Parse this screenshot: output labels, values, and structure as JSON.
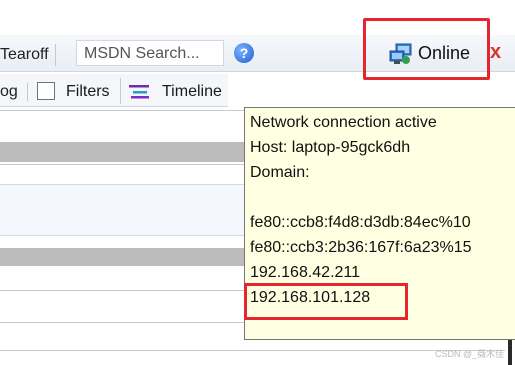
{
  "toolbar": {
    "tearoff_label": "Tearoff",
    "search_placeholder": "MSDN Search...",
    "help_glyph": "?",
    "online_label": "Online",
    "close_glyph": "x"
  },
  "filterbar": {
    "log_label": "og",
    "filters_label": "Filters",
    "timeline_label": "Timeline"
  },
  "tooltip": {
    "lines": [
      "Network connection active",
      "Host: laptop-95gck6dh",
      "Domain:",
      "",
      "fe80::ccb8:f4d8:d3db:84ec%10",
      "fe80::ccb3:2b36:167f:6a23%15",
      "192.168.42.211",
      "192.168.101.128"
    ]
  },
  "watermark": "CSDN @_薇木佳",
  "colors": {
    "highlight_box": "#e4262e",
    "tooltip_bg": "#ffffe1",
    "close_x": "#d9352b"
  },
  "icons": {
    "online": "network-computers-icon",
    "help": "help-circle-icon",
    "timeline": "timeline-icon",
    "filters": "checkbox-icon"
  }
}
